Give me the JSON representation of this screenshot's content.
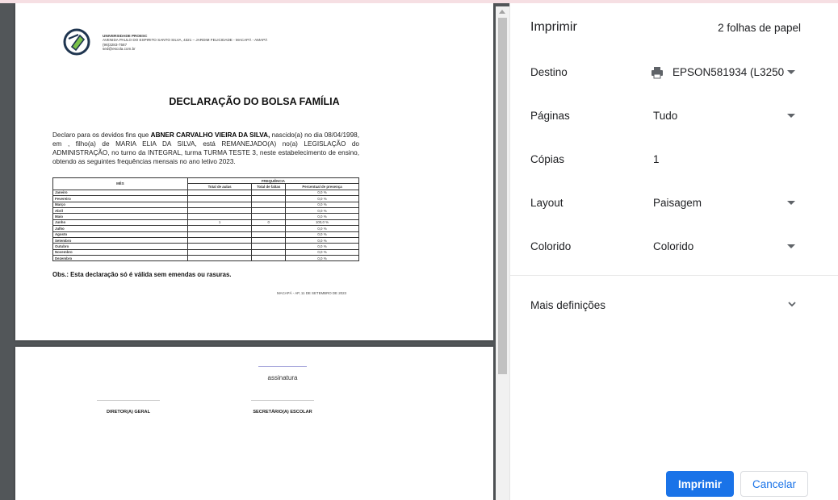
{
  "document": {
    "school": {
      "name": "UNIVERSIDADE PROESC",
      "address": "AVENIDA PAULO DO ESPIRITO SANTO SILVA, 4321 – JARDIM FELICIDADE - MACAPÁ - AMAPÁ",
      "phone": "(96)3283-7587",
      "email": "sed@escola.com.br"
    },
    "title": "DECLARAÇÃO DO BOLSA FAMÍLIA",
    "body_prefix": "Declaro para os devidos fins que ",
    "student_name": "ABNER CARVALHO VIEIRA DA SILVA,",
    "body_suffix": " nascido(a) no dia 08/04/1998, em , filho(a) de MARIA ELIA DA SILVA, está REMANEJADO(A) no(a) LEGISLAÇÃO do ADMINISTRAÇÃO, no turno da INTEGRAL, turma TURMA TESTE 3, neste estabelecimento de ensino, obtendo as seguintes frequências mensais no ano letivo 2023.",
    "table": {
      "col_month": "MÊS",
      "col_group": "FREQUÊNCIA",
      "col_classes": "Total de aulas",
      "col_absences": "Total de faltas",
      "col_percent": "Percentual de presença",
      "rows": [
        {
          "month": "Janeiro",
          "classes": "",
          "absences": "",
          "percent": "0,0 %"
        },
        {
          "month": "Fevereiro",
          "classes": "",
          "absences": "",
          "percent": "0,0 %"
        },
        {
          "month": "Março",
          "classes": "",
          "absences": "",
          "percent": "0,0 %"
        },
        {
          "month": "Abril",
          "classes": "",
          "absences": "",
          "percent": "0,0 %"
        },
        {
          "month": "Maio",
          "classes": "",
          "absences": "",
          "percent": "0,0 %"
        },
        {
          "month": "Junho",
          "classes": "1",
          "absences": "0",
          "percent": "100,0 %"
        },
        {
          "month": "Julho",
          "classes": "",
          "absences": "",
          "percent": "0,0 %"
        },
        {
          "month": "Agosto",
          "classes": "",
          "absences": "",
          "percent": "0,0 %"
        },
        {
          "month": "Setembro",
          "classes": "",
          "absences": "",
          "percent": "0,0 %"
        },
        {
          "month": "Outubro",
          "classes": "",
          "absences": "",
          "percent": "0,0 %"
        },
        {
          "month": "Novembro",
          "classes": "",
          "absences": "",
          "percent": "0,0 %"
        },
        {
          "month": "Dezembro",
          "classes": "",
          "absences": "",
          "percent": "0,0 %"
        }
      ]
    },
    "obs": "Obs.: Esta declaração só é válida sem emendas ou rasuras.",
    "place_date": "MACAPÁ - AP, 11 DE SETEMBRO DE 2023",
    "signature_label": "assinatura",
    "role_director": "DIRETOR(A) GERAL",
    "role_secretary": "SECRETÁRIO(A) ESCOLAR"
  },
  "panel": {
    "title": "Imprimir",
    "sheet_count": "2 folhas de papel",
    "destination_label": "Destino",
    "destination_value": "EPSON581934 (L3250",
    "pages_label": "Páginas",
    "pages_value": "Tudo",
    "copies_label": "Cópias",
    "copies_value": "1",
    "layout_label": "Layout",
    "layout_value": "Paisagem",
    "color_label": "Colorido",
    "color_value": "Colorido",
    "more_settings": "Mais definições",
    "print_button": "Imprimir",
    "cancel_button": "Cancelar"
  },
  "icons": {
    "printer": "printer-icon",
    "dropdown": "triangle-down-icon",
    "more": "chevron-down-icon",
    "accent": "#1a73e8"
  }
}
